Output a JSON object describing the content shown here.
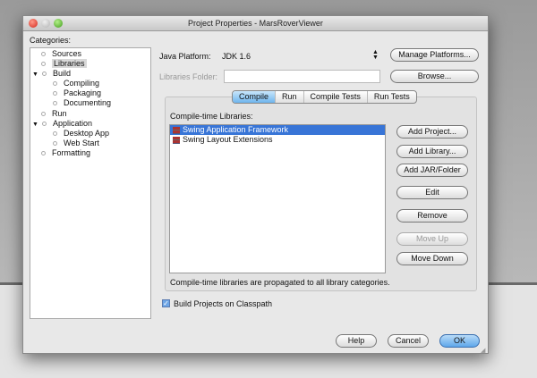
{
  "window": {
    "title": "Project Properties - MarsRoverViewer"
  },
  "categories": {
    "label": "Categories:",
    "items": [
      {
        "label": "Sources"
      },
      {
        "label": "Libraries"
      },
      {
        "label": "Build"
      },
      {
        "label": "Compiling"
      },
      {
        "label": "Packaging"
      },
      {
        "label": "Documenting"
      },
      {
        "label": "Run"
      },
      {
        "label": "Application"
      },
      {
        "label": "Desktop App"
      },
      {
        "label": "Web Start"
      },
      {
        "label": "Formatting"
      }
    ],
    "selected": "Libraries"
  },
  "platform": {
    "label": "Java Platform:",
    "value": "JDK 1.6",
    "manage_label": "Manage Platforms..."
  },
  "folder": {
    "label": "Libraries Folder:",
    "value": "",
    "browse_label": "Browse..."
  },
  "tabs": [
    {
      "label": "Compile"
    },
    {
      "label": "Run"
    },
    {
      "label": "Compile Tests"
    },
    {
      "label": "Run Tests"
    }
  ],
  "active_tab": "Compile",
  "libs": {
    "label": "Compile-time Libraries:",
    "items": [
      {
        "label": "Swing Application Framework"
      },
      {
        "label": "Swing Layout Extensions"
      }
    ],
    "note": "Compile-time libraries are propagated to all library categories.",
    "buttons": {
      "add_project": "Add Project...",
      "add_library": "Add Library...",
      "add_jar": "Add JAR/Folder",
      "edit": "Edit",
      "remove": "Remove",
      "move_up": "Move Up",
      "move_down": "Move Down"
    }
  },
  "build_classpath": {
    "label": "Build Projects on Classpath",
    "checked": true
  },
  "footer": {
    "help": "Help",
    "cancel": "Cancel",
    "ok": "OK"
  }
}
